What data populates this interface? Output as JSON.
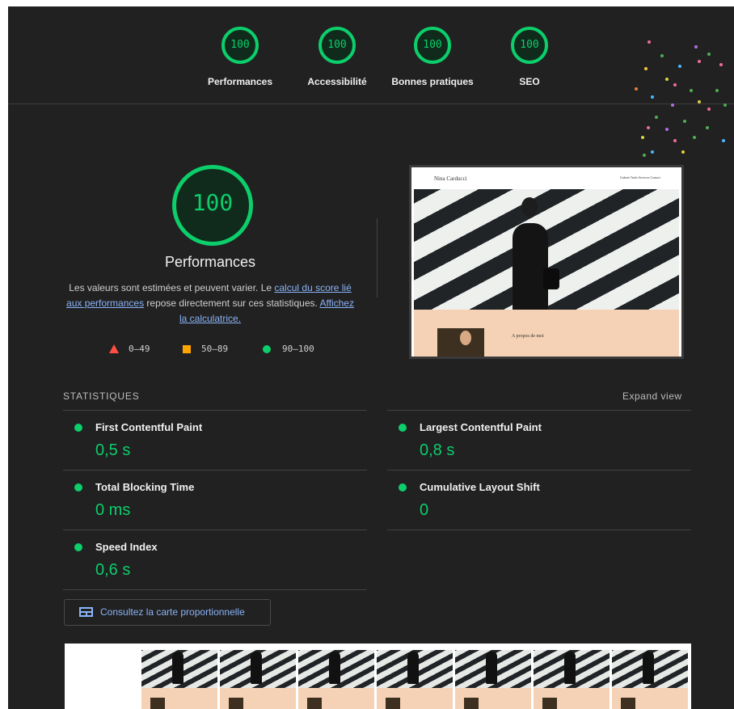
{
  "colors": {
    "pass": "#0cce6b",
    "average": "#ffa400",
    "fail": "#ff4e42",
    "link": "#8ab4f8",
    "background": "#212121"
  },
  "gauges": [
    {
      "score": "100",
      "label": "Performances"
    },
    {
      "score": "100",
      "label": "Accessibilité"
    },
    {
      "score": "100",
      "label": "Bonnes pratiques"
    },
    {
      "score": "100",
      "label": "SEO"
    }
  ],
  "performance": {
    "score": "100",
    "title": "Performances",
    "description": {
      "part1": "Les valeurs sont estimées et peuvent varier. Le ",
      "link1": "calcul du score lié aux performances",
      "part2": " repose directement sur ces statistiques. ",
      "link2": "Affichez la calculatrice."
    },
    "legend": [
      {
        "icon": "triangle-icon",
        "range": "0–49"
      },
      {
        "icon": "square-icon",
        "range": "50–89"
      },
      {
        "icon": "circle-icon",
        "range": "90–100"
      }
    ]
  },
  "screenshot": {
    "site_name": "Nina Carducci",
    "nav": "Galerie  Tarifs  Services  Contact",
    "section": "A propos de moi"
  },
  "statistics": {
    "heading": "STATISTIQUES",
    "expand": "Expand view",
    "metrics": [
      {
        "name": "First Contentful Paint",
        "value": "0,5 s"
      },
      {
        "name": "Largest Contentful Paint",
        "value": "0,8 s"
      },
      {
        "name": "Total Blocking Time",
        "value": "0 ms"
      },
      {
        "name": "Cumulative Layout Shift",
        "value": "0"
      },
      {
        "name": "Speed Index",
        "value": "0,6 s"
      }
    ],
    "treemap_button": "Consultez la carte proportionnelle",
    "treemap_icon": "treemap-icon"
  }
}
